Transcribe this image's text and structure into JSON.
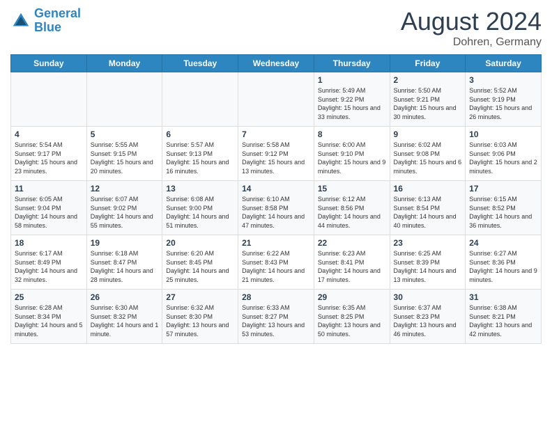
{
  "header": {
    "logo_line1": "General",
    "logo_line2": "Blue",
    "month_title": "August 2024",
    "location": "Dohren, Germany"
  },
  "weekdays": [
    "Sunday",
    "Monday",
    "Tuesday",
    "Wednesday",
    "Thursday",
    "Friday",
    "Saturday"
  ],
  "weeks": [
    [
      {
        "day": "",
        "info": ""
      },
      {
        "day": "",
        "info": ""
      },
      {
        "day": "",
        "info": ""
      },
      {
        "day": "",
        "info": ""
      },
      {
        "day": "1",
        "info": "Sunrise: 5:49 AM\nSunset: 9:22 PM\nDaylight: 15 hours\nand 33 minutes."
      },
      {
        "day": "2",
        "info": "Sunrise: 5:50 AM\nSunset: 9:21 PM\nDaylight: 15 hours\nand 30 minutes."
      },
      {
        "day": "3",
        "info": "Sunrise: 5:52 AM\nSunset: 9:19 PM\nDaylight: 15 hours\nand 26 minutes."
      }
    ],
    [
      {
        "day": "4",
        "info": "Sunrise: 5:54 AM\nSunset: 9:17 PM\nDaylight: 15 hours\nand 23 minutes."
      },
      {
        "day": "5",
        "info": "Sunrise: 5:55 AM\nSunset: 9:15 PM\nDaylight: 15 hours\nand 20 minutes."
      },
      {
        "day": "6",
        "info": "Sunrise: 5:57 AM\nSunset: 9:13 PM\nDaylight: 15 hours\nand 16 minutes."
      },
      {
        "day": "7",
        "info": "Sunrise: 5:58 AM\nSunset: 9:12 PM\nDaylight: 15 hours\nand 13 minutes."
      },
      {
        "day": "8",
        "info": "Sunrise: 6:00 AM\nSunset: 9:10 PM\nDaylight: 15 hours\nand 9 minutes."
      },
      {
        "day": "9",
        "info": "Sunrise: 6:02 AM\nSunset: 9:08 PM\nDaylight: 15 hours\nand 6 minutes."
      },
      {
        "day": "10",
        "info": "Sunrise: 6:03 AM\nSunset: 9:06 PM\nDaylight: 15 hours\nand 2 minutes."
      }
    ],
    [
      {
        "day": "11",
        "info": "Sunrise: 6:05 AM\nSunset: 9:04 PM\nDaylight: 14 hours\nand 58 minutes."
      },
      {
        "day": "12",
        "info": "Sunrise: 6:07 AM\nSunset: 9:02 PM\nDaylight: 14 hours\nand 55 minutes."
      },
      {
        "day": "13",
        "info": "Sunrise: 6:08 AM\nSunset: 9:00 PM\nDaylight: 14 hours\nand 51 minutes."
      },
      {
        "day": "14",
        "info": "Sunrise: 6:10 AM\nSunset: 8:58 PM\nDaylight: 14 hours\nand 47 minutes."
      },
      {
        "day": "15",
        "info": "Sunrise: 6:12 AM\nSunset: 8:56 PM\nDaylight: 14 hours\nand 44 minutes."
      },
      {
        "day": "16",
        "info": "Sunrise: 6:13 AM\nSunset: 8:54 PM\nDaylight: 14 hours\nand 40 minutes."
      },
      {
        "day": "17",
        "info": "Sunrise: 6:15 AM\nSunset: 8:52 PM\nDaylight: 14 hours\nand 36 minutes."
      }
    ],
    [
      {
        "day": "18",
        "info": "Sunrise: 6:17 AM\nSunset: 8:49 PM\nDaylight: 14 hours\nand 32 minutes."
      },
      {
        "day": "19",
        "info": "Sunrise: 6:18 AM\nSunset: 8:47 PM\nDaylight: 14 hours\nand 28 minutes."
      },
      {
        "day": "20",
        "info": "Sunrise: 6:20 AM\nSunset: 8:45 PM\nDaylight: 14 hours\nand 25 minutes."
      },
      {
        "day": "21",
        "info": "Sunrise: 6:22 AM\nSunset: 8:43 PM\nDaylight: 14 hours\nand 21 minutes."
      },
      {
        "day": "22",
        "info": "Sunrise: 6:23 AM\nSunset: 8:41 PM\nDaylight: 14 hours\nand 17 minutes."
      },
      {
        "day": "23",
        "info": "Sunrise: 6:25 AM\nSunset: 8:39 PM\nDaylight: 14 hours\nand 13 minutes."
      },
      {
        "day": "24",
        "info": "Sunrise: 6:27 AM\nSunset: 8:36 PM\nDaylight: 14 hours\nand 9 minutes."
      }
    ],
    [
      {
        "day": "25",
        "info": "Sunrise: 6:28 AM\nSunset: 8:34 PM\nDaylight: 14 hours\nand 5 minutes."
      },
      {
        "day": "26",
        "info": "Sunrise: 6:30 AM\nSunset: 8:32 PM\nDaylight: 14 hours\nand 1 minute."
      },
      {
        "day": "27",
        "info": "Sunrise: 6:32 AM\nSunset: 8:30 PM\nDaylight: 13 hours\nand 57 minutes."
      },
      {
        "day": "28",
        "info": "Sunrise: 6:33 AM\nSunset: 8:27 PM\nDaylight: 13 hours\nand 53 minutes."
      },
      {
        "day": "29",
        "info": "Sunrise: 6:35 AM\nSunset: 8:25 PM\nDaylight: 13 hours\nand 50 minutes."
      },
      {
        "day": "30",
        "info": "Sunrise: 6:37 AM\nSunset: 8:23 PM\nDaylight: 13 hours\nand 46 minutes."
      },
      {
        "day": "31",
        "info": "Sunrise: 6:38 AM\nSunset: 8:21 PM\nDaylight: 13 hours\nand 42 minutes."
      }
    ]
  ]
}
